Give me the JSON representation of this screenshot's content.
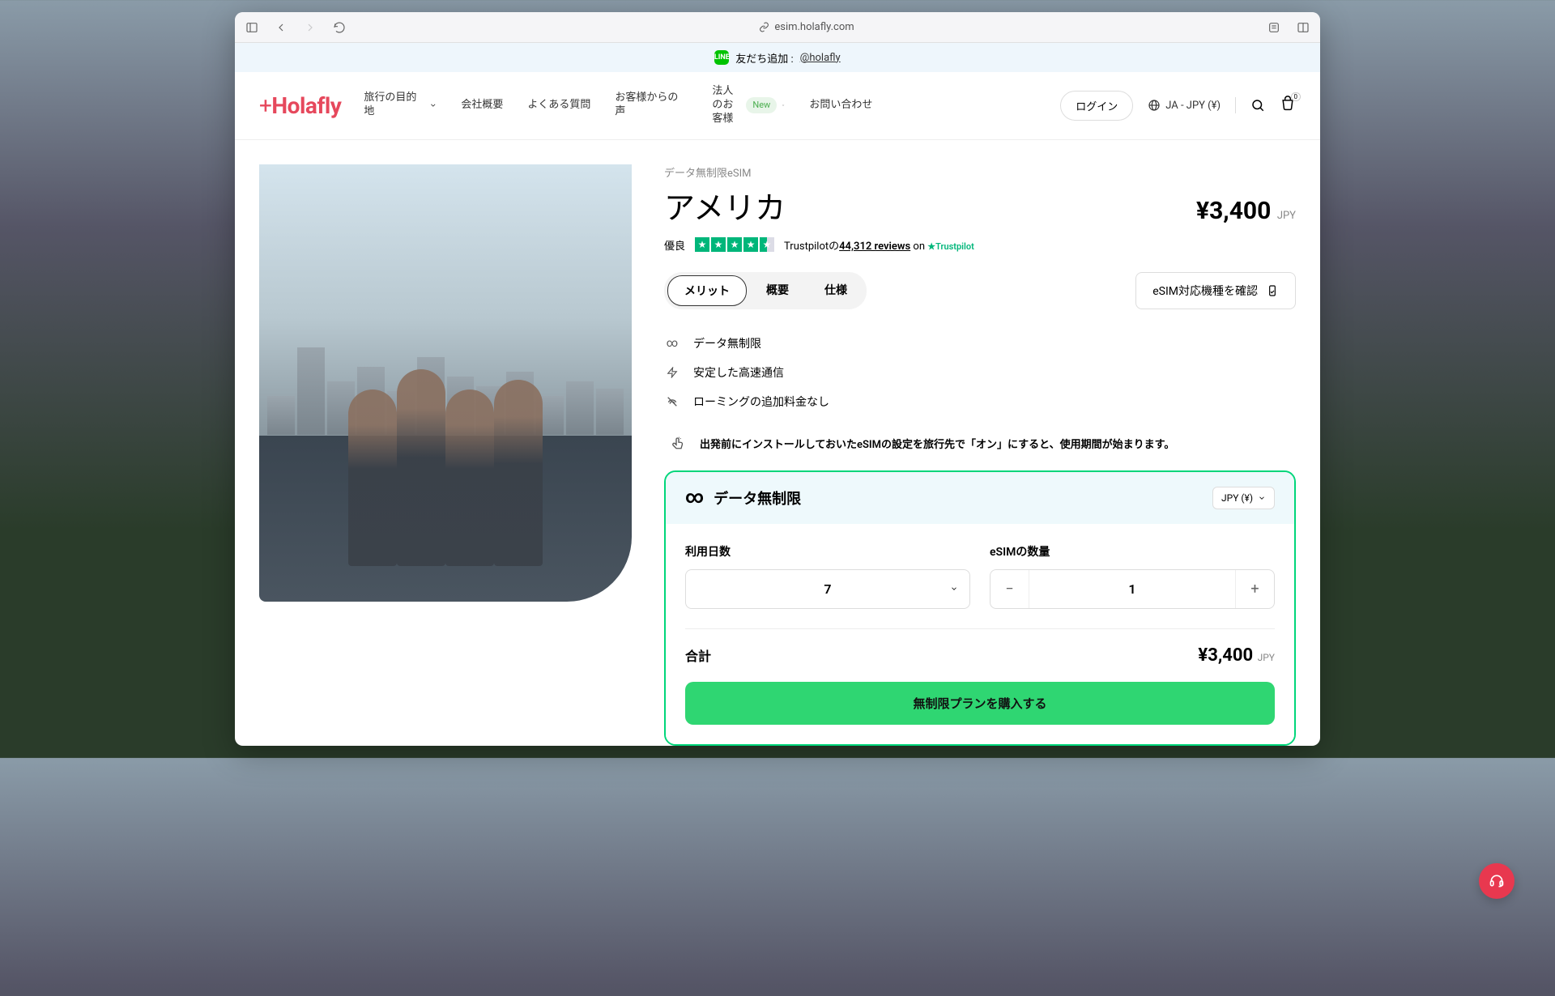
{
  "browser": {
    "url": "esim.holafly.com"
  },
  "announce": {
    "text": "友だち追加 : ",
    "link": "@holafly"
  },
  "logo": "Holafly",
  "nav": {
    "items": [
      "旅行の目的地",
      "会社概要",
      "よくある質問",
      "お客様からの声",
      "法人のお客様",
      "お問い合わせ"
    ],
    "new_badge": "New"
  },
  "header": {
    "login": "ログイン",
    "locale": "JA - JPY (¥)",
    "cart_count": "0"
  },
  "product": {
    "subtitle": "データ無制限eSIM",
    "title": "アメリカ",
    "price": "¥3,400",
    "currency": "JPY"
  },
  "trustpilot": {
    "rating_label": "優良",
    "prefix": "Trustpilotの",
    "reviews": "44,312 reviews",
    "on": " on",
    "brand": "Trustpilot"
  },
  "tabs": {
    "merit": "メリット",
    "overview": "概要",
    "spec": "仕様"
  },
  "check_device": "eSIM対応機種を確認",
  "features": {
    "unlimited": "データ無制限",
    "speed": "安定した高速通信",
    "roaming": "ローミングの追加料金なし"
  },
  "note": "出発前にインストールしておいたeSIMの設定を旅行先で「オン」にすると、使用期間が始まります。",
  "plan": {
    "title": "データ無制限",
    "currency_sel": "JPY (¥)",
    "days_label": "利用日数",
    "days_value": "7",
    "qty_label": "eSIMの数量",
    "qty_value": "1",
    "total_label": "合計",
    "total_price": "¥3,400",
    "total_currency": "JPY",
    "buy": "無制限プランを購入する"
  }
}
